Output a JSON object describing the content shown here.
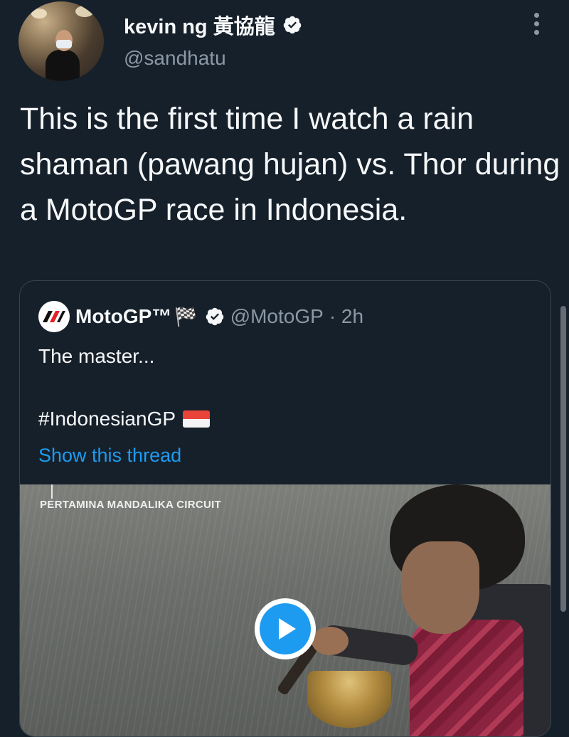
{
  "author": {
    "display_name": "kevin ng 黃協龍",
    "handle": "@sandhatu",
    "verified": true
  },
  "tweet": {
    "text": "This is the first time I watch a rain shaman (pawang hujan) vs. Thor during a MotoGP race in Indonesia."
  },
  "quoted_tweet": {
    "display_name": "MotoGP™",
    "flag_icon": "🏁",
    "handle": "@MotoGP",
    "time": "· 2h",
    "text_line1": "The master...",
    "hashtag": "#IndonesianGP",
    "show_thread": "Show this thread",
    "media": {
      "caption": "PERTAMINA MANDALIKA CIRCUIT",
      "type": "video"
    }
  },
  "colors": {
    "background": "#16202b",
    "accent": "#1d9bf0",
    "secondary_text": "#8b98a5"
  }
}
